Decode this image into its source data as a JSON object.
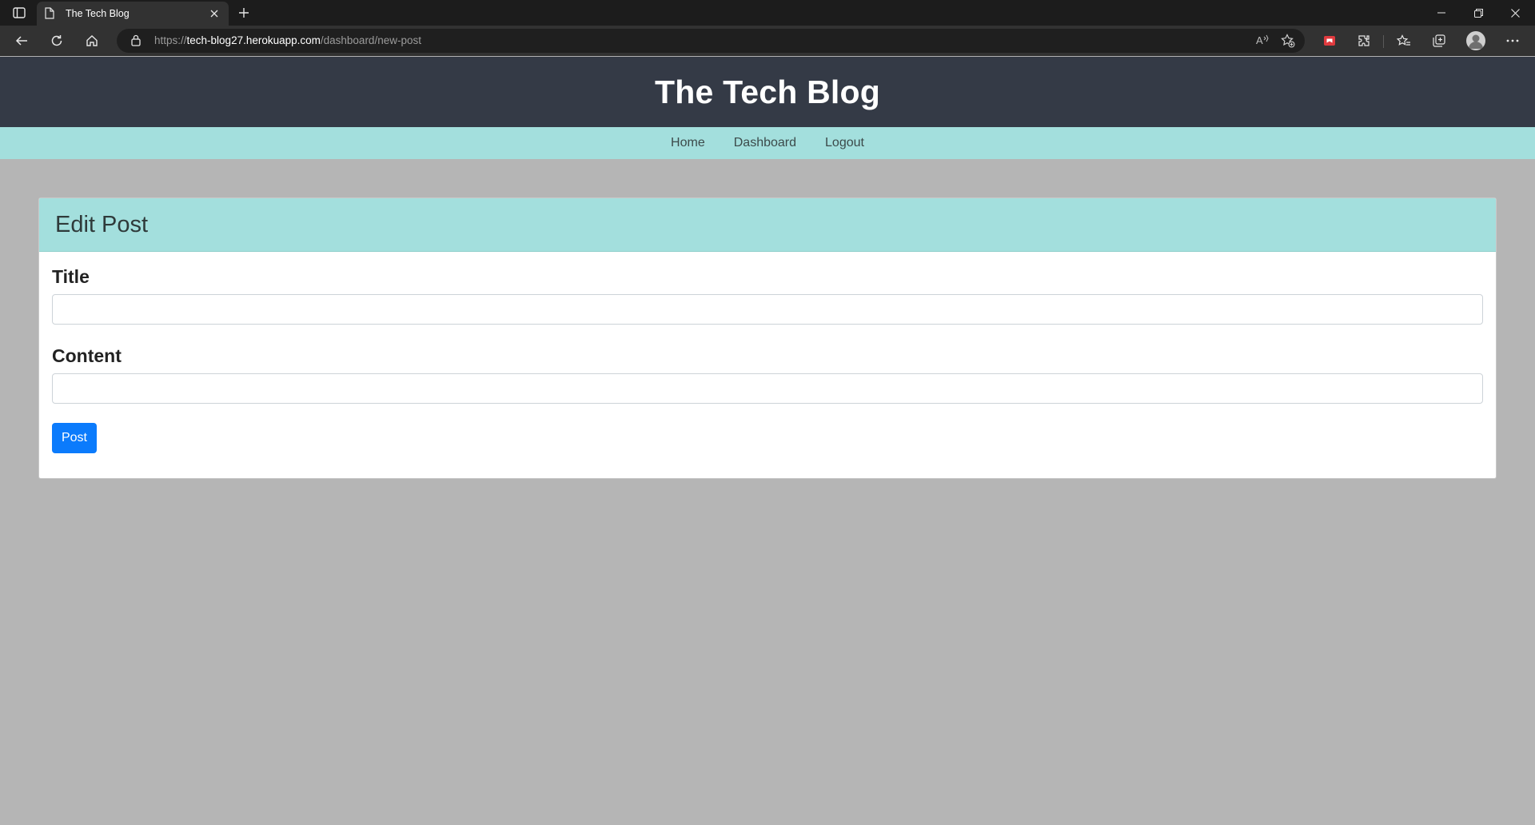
{
  "browser": {
    "tab_title": "The Tech Blog",
    "url_prefix": "https://",
    "url_host": "tech-blog27.herokuapp.com",
    "url_path": "/dashboard/new-post"
  },
  "header": {
    "site_title": "The Tech Blog"
  },
  "nav": {
    "items": [
      {
        "label": "Home"
      },
      {
        "label": "Dashboard"
      },
      {
        "label": "Logout"
      }
    ]
  },
  "card": {
    "title": "Edit Post",
    "title_label": "Title",
    "title_value": "",
    "content_label": "Content",
    "content_value": "",
    "submit_label": "Post"
  },
  "colors": {
    "header_bg": "#343a46",
    "nav_bg": "#a3dfdd",
    "page_bg": "#b5b5b5",
    "button_bg": "#0b7bfc"
  }
}
